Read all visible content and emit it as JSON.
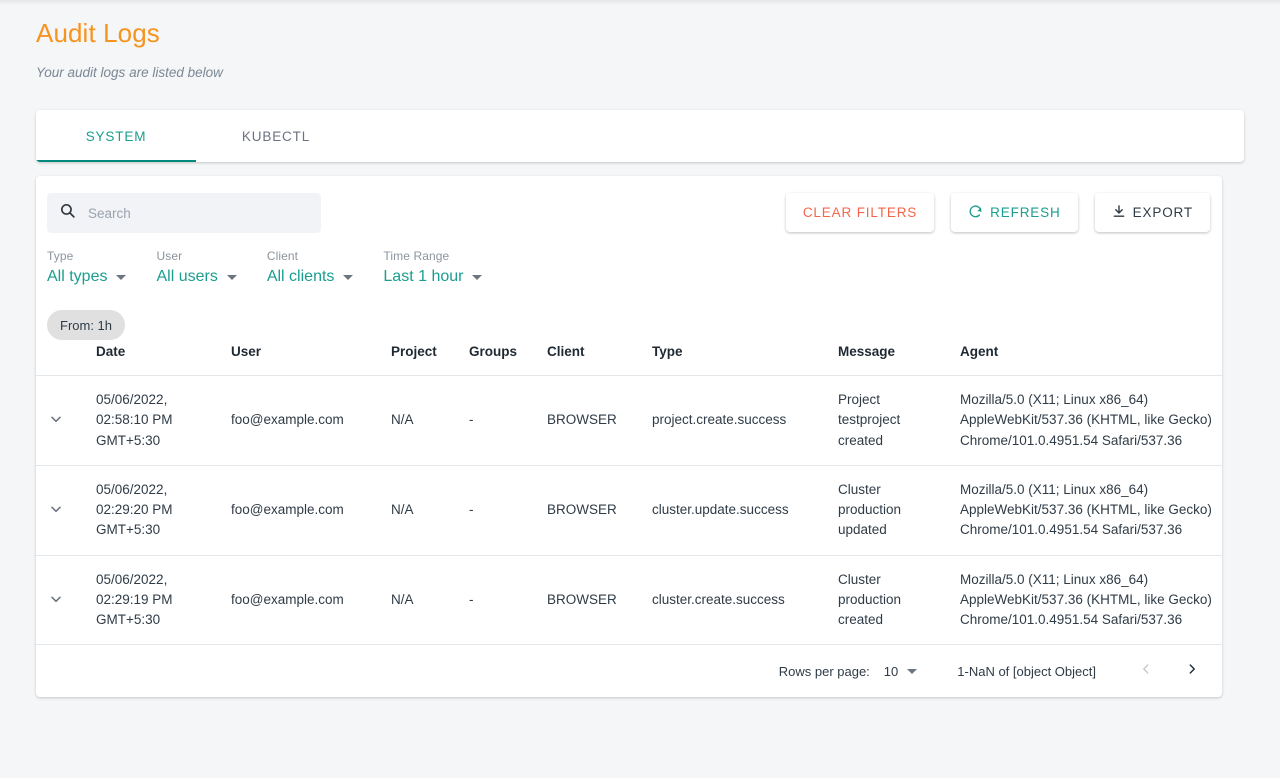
{
  "header": {
    "title": "Audit Logs",
    "subtitle": "Your audit logs are listed below"
  },
  "tabs": [
    {
      "label": "SYSTEM",
      "active": true
    },
    {
      "label": "KUBECTL",
      "active": false
    }
  ],
  "toolbar": {
    "search_placeholder": "Search",
    "search_value": "",
    "search_icon": "search-icon",
    "buttons": {
      "clear_filters": "CLEAR FILTERS",
      "refresh": "REFRESH",
      "refresh_icon": "refresh-icon",
      "export": "EXPORT",
      "export_icon": "download-icon"
    }
  },
  "filters": [
    {
      "label": "Type",
      "value": "All types"
    },
    {
      "label": "User",
      "value": "All users"
    },
    {
      "label": "Client",
      "value": "All clients"
    },
    {
      "label": "Time Range",
      "value": "Last 1 hour"
    }
  ],
  "chips": [
    {
      "label": "From: 1h"
    }
  ],
  "table": {
    "columns": [
      "",
      "Date",
      "User",
      "Project",
      "Groups",
      "Client",
      "Type",
      "Message",
      "Agent"
    ],
    "rows": [
      {
        "expand_icon": "chevron-down-icon",
        "date": "05/06/2022, 02:58:10 PM GMT+5:30",
        "user": "foo@example.com",
        "project": "N/A",
        "groups": "-",
        "client": "BROWSER",
        "type": "project.create.success",
        "message": "Project testproject created",
        "agent": "Mozilla/5.0 (X11; Linux x86_64) AppleWebKit/537.36 (KHTML, like Gecko) Chrome/101.0.4951.54 Safari/537.36"
      },
      {
        "expand_icon": "chevron-down-icon",
        "date": "05/06/2022, 02:29:20 PM GMT+5:30",
        "user": "foo@example.com",
        "project": "N/A",
        "groups": "-",
        "client": "BROWSER",
        "type": "cluster.update.success",
        "message": "Cluster production updated",
        "agent": "Mozilla/5.0 (X11; Linux x86_64) AppleWebKit/537.36 (KHTML, like Gecko) Chrome/101.0.4951.54 Safari/537.36"
      },
      {
        "expand_icon": "chevron-down-icon",
        "date": "05/06/2022, 02:29:19 PM GMT+5:30",
        "user": "foo@example.com",
        "project": "N/A",
        "groups": "-",
        "client": "BROWSER",
        "type": "cluster.create.success",
        "message": "Cluster production created",
        "agent": "Mozilla/5.0 (X11; Linux x86_64) AppleWebKit/537.36 (KHTML, like Gecko) Chrome/101.0.4951.54 Safari/537.36"
      }
    ]
  },
  "pagination": {
    "rows_per_page_label": "Rows per page:",
    "rows_per_page_value": "10",
    "range_text": "1-NaN of [object Object]",
    "prev_icon": "chevron-left-icon",
    "next_icon": "chevron-right-icon",
    "prev_enabled": false,
    "next_enabled": true
  },
  "colors": {
    "title": "#f7941e",
    "accent_teal": "#1a9e8f",
    "tab_underline": "#00897b",
    "danger": "#f4664a",
    "page_bg": "#f4f6f8",
    "card_bg": "#ffffff",
    "chip_bg": "#e0e0e0"
  }
}
